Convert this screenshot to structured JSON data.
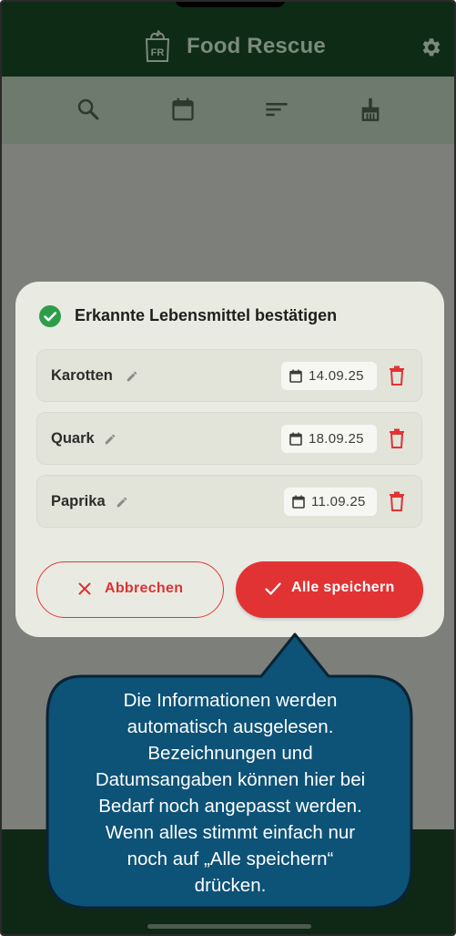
{
  "app": {
    "title": "Food Rescue",
    "logo_text": "FR"
  },
  "toolbar": {
    "icons": [
      "search-icon",
      "calendar-icon",
      "sort-icon",
      "cleaning-brush-icon"
    ]
  },
  "dialog": {
    "title": "Erkannte Lebensmittel bestätigen",
    "items": [
      {
        "name": "Karotten",
        "date": "14.09.25"
      },
      {
        "name": "Quark",
        "date": "18.09.25"
      },
      {
        "name": "Paprika",
        "date": "11.09.25"
      }
    ],
    "cancel_label": "Abbrechen",
    "save_label": "Alle speichern"
  },
  "tooltip": {
    "lines": [
      "Die Informationen werden",
      "automatisch ausgelesen.",
      "Bezeichnungen und",
      "Datumsangaben können hier bei",
      "Bedarf noch angepasst werden.",
      "Wenn alles stimmt einfach nur",
      "noch auf „Alle speichern“",
      "drücken."
    ]
  },
  "colors": {
    "appbar": "#0e2b16",
    "accent_red": "#e23334",
    "success_green": "#2e9d4a",
    "tooltip_bg": "#0d5277",
    "dialog_bg": "#e9ebe2"
  }
}
